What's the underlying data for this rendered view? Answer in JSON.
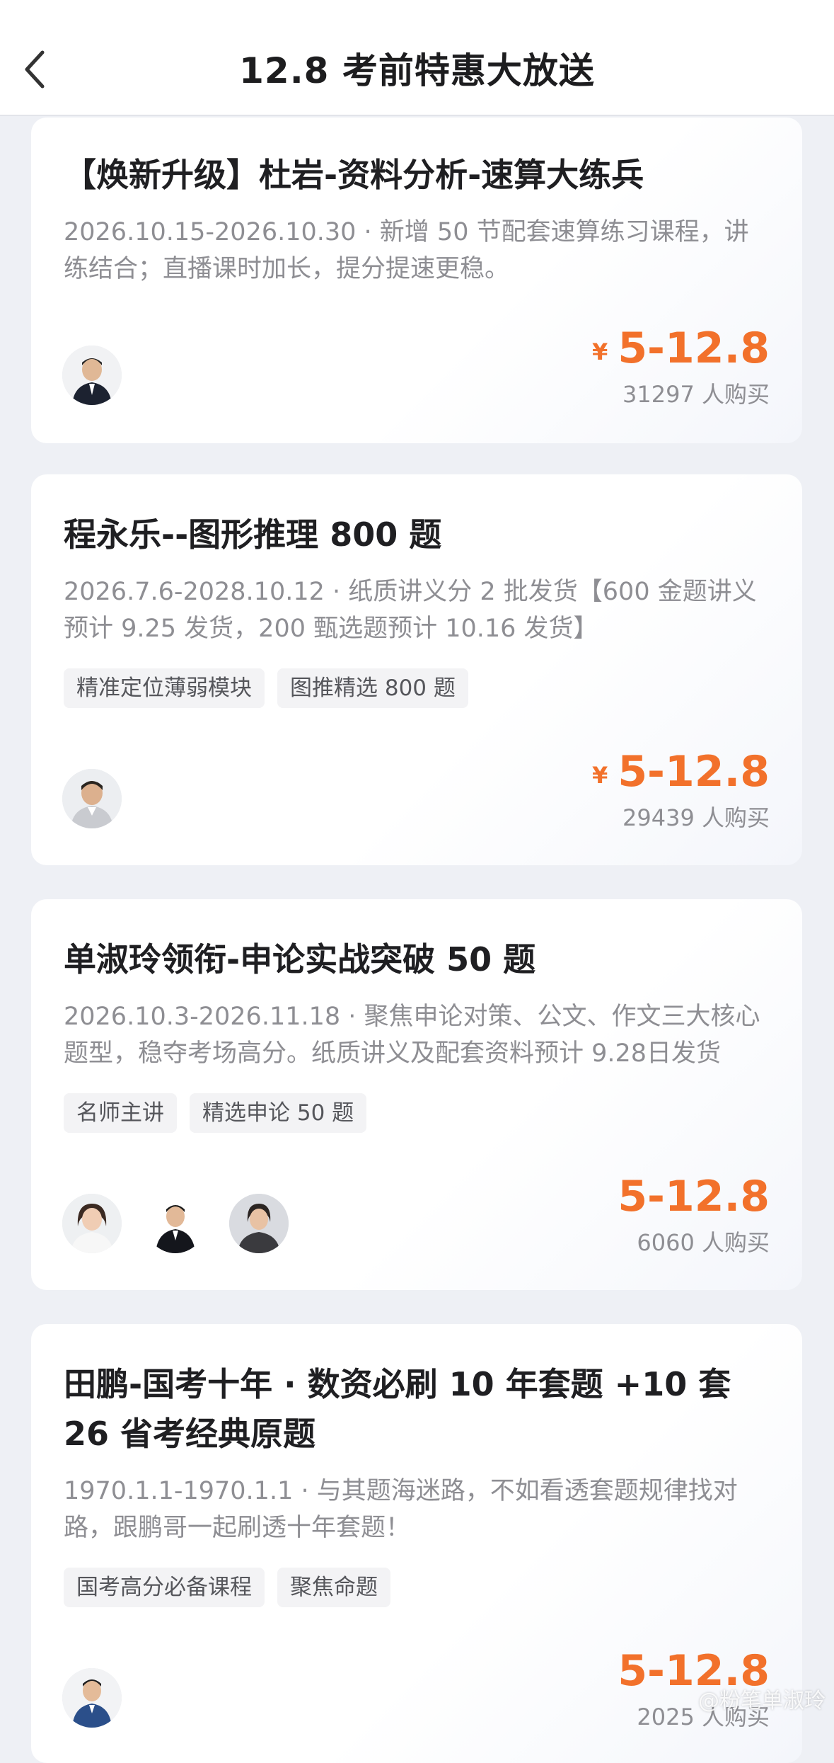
{
  "header": {
    "title": "12.8 考前特惠大放送"
  },
  "courses": [
    {
      "title": "【焕新升级】杜岩-资料分析-速算大练兵",
      "desc": "2026.10.15-2026.10.30 · 新增 50 节配套速算练习课程，讲练结合；直播课时加长，提分提速更稳。",
      "tags": [],
      "price": "5-12.8",
      "currency": "¥",
      "buyers": "31297 人购买"
    },
    {
      "title": "程永乐--图形推理 800 题",
      "desc": "2026.7.6-2028.10.12 · 纸质讲义分 2 批发货【600 金题讲义预计 9.25 发货，200 甄选题预计 10.16 发货】",
      "tags": [
        "精准定位薄弱模块",
        "图推精选 800 题"
      ],
      "price": "5-12.8",
      "currency": "¥",
      "buyers": "29439 人购买"
    },
    {
      "title": "单淑玲领衔-申论实战突破 50 题",
      "desc": "2026.10.3-2026.11.18 · 聚焦申论对策、公文、作文三大核心题型，稳夺考场高分。纸质讲义及配套资料预计 9.28日发货",
      "tags": [
        "名师主讲",
        "精选申论 50 题"
      ],
      "price": "5-12.8",
      "currency": "",
      "buyers": "6060 人购买"
    },
    {
      "title": "田鹏-国考十年 · 数资必刷 10 年套题 +10 套 26 省考经典原题",
      "desc": "1970.1.1-1970.1.1 · 与其题海迷路，不如看透套题规律找对路，跟鹏哥一起刷透十年套题！",
      "tags": [
        "国考高分必备课程",
        "聚焦命题"
      ],
      "price": "5-12.8",
      "currency": "",
      "buyers": "2025 人购买"
    }
  ],
  "watermark": "@粉笔单淑玲"
}
